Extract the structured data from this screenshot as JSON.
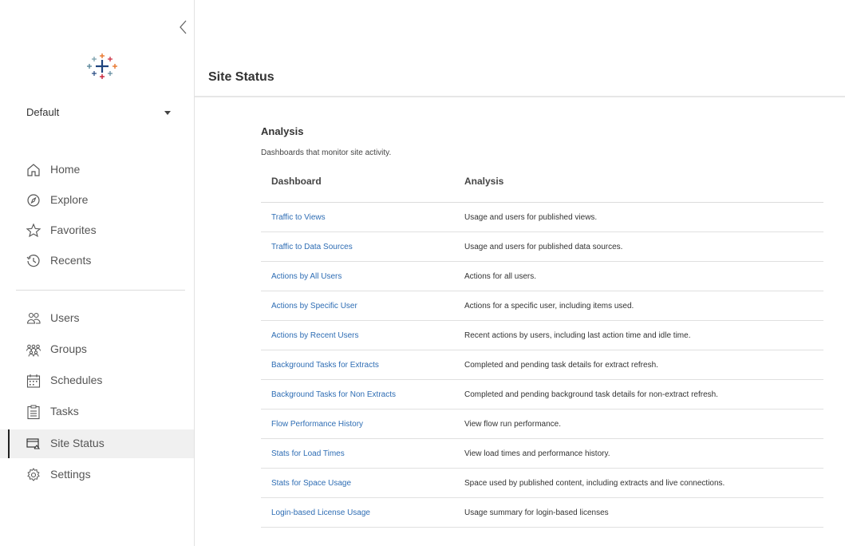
{
  "sidebar": {
    "site_selector": {
      "selected": "Default"
    },
    "nav_primary": [
      {
        "label": "Home",
        "icon": "home-icon"
      },
      {
        "label": "Explore",
        "icon": "explore-icon"
      },
      {
        "label": "Favorites",
        "icon": "star-icon"
      },
      {
        "label": "Recents",
        "icon": "recents-icon"
      }
    ],
    "nav_admin": [
      {
        "label": "Users",
        "icon": "users-icon"
      },
      {
        "label": "Groups",
        "icon": "groups-icon"
      },
      {
        "label": "Schedules",
        "icon": "schedules-icon"
      },
      {
        "label": "Tasks",
        "icon": "tasks-icon"
      },
      {
        "label": "Site Status",
        "icon": "site-status-icon",
        "active": true
      },
      {
        "label": "Settings",
        "icon": "settings-icon"
      }
    ]
  },
  "header": {
    "title": "Site Status"
  },
  "main": {
    "section_title": "Analysis",
    "section_description": "Dashboards that monitor site activity.",
    "table": {
      "columns": [
        "Dashboard",
        "Analysis"
      ],
      "rows": [
        {
          "dashboard": "Traffic to Views",
          "analysis": "Usage and users for published views."
        },
        {
          "dashboard": "Traffic to Data Sources",
          "analysis": "Usage and users for published data sources."
        },
        {
          "dashboard": "Actions by All Users",
          "analysis": "Actions for all users."
        },
        {
          "dashboard": "Actions by Specific User",
          "analysis": "Actions for a specific user, including items used."
        },
        {
          "dashboard": "Actions by Recent Users",
          "analysis": "Recent actions by users, including last action time and idle time."
        },
        {
          "dashboard": "Background Tasks for Extracts",
          "analysis": "Completed and pending task details for extract refresh."
        },
        {
          "dashboard": "Background Tasks for Non Extracts",
          "analysis": "Completed and pending background task details for non-extract refresh."
        },
        {
          "dashboard": "Flow Performance History",
          "analysis": "View flow run performance."
        },
        {
          "dashboard": "Stats for Load Times",
          "analysis": "View load times and performance history."
        },
        {
          "dashboard": "Stats for Space Usage",
          "analysis": "Space used by published content, including extracts and live connections."
        },
        {
          "dashboard": "Login-based License Usage",
          "analysis": "Usage summary for login-based licenses"
        }
      ]
    }
  },
  "colors": {
    "link": "#2e6db4",
    "active_bg": "#f0f0f0",
    "active_marker": "#1f1f1f",
    "logo_blue": "#1f447e",
    "logo_orange": "#e8762c",
    "logo_red": "#c72035",
    "logo_teal": "#5b879b",
    "logo_lightblue": "#7099a6"
  }
}
